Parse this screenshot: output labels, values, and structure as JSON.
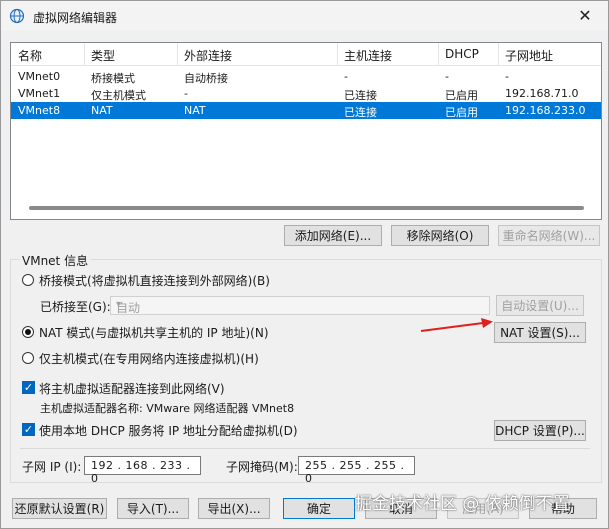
{
  "window": {
    "title": "虚拟网络编辑器",
    "close_symbol": "✕"
  },
  "table": {
    "columns": [
      "名称",
      "类型",
      "外部连接",
      "主机连接",
      "DHCP",
      "子网地址"
    ],
    "rows": [
      {
        "name": "VMnet0",
        "type": "桥接模式",
        "external": "自动桥接",
        "host": "-",
        "dhcp": "-",
        "subnet": "-"
      },
      {
        "name": "VMnet1",
        "type": "仅主机模式",
        "external": "-",
        "host": "已连接",
        "dhcp": "已启用",
        "subnet": "192.168.71.0"
      },
      {
        "name": "VMnet8",
        "type": "NAT",
        "external": "NAT",
        "host": "已连接",
        "dhcp": "已启用",
        "subnet": "192.168.233.0"
      }
    ],
    "selected_row": "VMnet8"
  },
  "table_buttons": {
    "add": "添加网络(E)...",
    "remove": "移除网络(O)",
    "rename": "重命名网络(W)..."
  },
  "vmnet_info": {
    "group_label": "VMnet 信息",
    "bridge_radio": "桥接模式(将虚拟机直接连接到外部网络)(B)",
    "bridged_to_label": "已桥接至(G):",
    "bridged_to_value": "自动",
    "auto_settings": "自动设置(U)...",
    "nat_radio": "NAT 模式(与虚拟机共享主机的 IP 地址)(N)",
    "nat_settings": "NAT 设置(S)...",
    "hostonly_radio": "仅主机模式(在专用网络内连接虚拟机)(H)",
    "selected_mode": "NAT",
    "connect_adapter_check": "将主机虚拟适配器连接到此网络(V)",
    "adapter_name_text": "主机虚拟适配器名称: VMware 网络适配器 VMnet8",
    "dhcp_check": "使用本地 DHCP 服务将 IP 地址分配给虚拟机(D)",
    "dhcp_settings": "DHCP 设置(P)...",
    "subnet_ip_label": "子网 IP (I):",
    "subnet_ip_value": "192 . 168 . 233 .  0",
    "subnet_mask_label": "子网掩码(M):",
    "subnet_mask_value": "255 . 255 . 255 .  0"
  },
  "footer": {
    "restore": "还原默认设置(R)",
    "import": "导入(T)...",
    "export": "导出(X)...",
    "ok": "确定",
    "cancel": "取消",
    "apply": "应用(A)",
    "help": "帮助"
  },
  "watermark": "掘金技术社区 @ 依赖倒不置",
  "colors": {
    "selection": "#0078d7",
    "arrow": "#e0201f",
    "checkbox": "#0067c0"
  }
}
